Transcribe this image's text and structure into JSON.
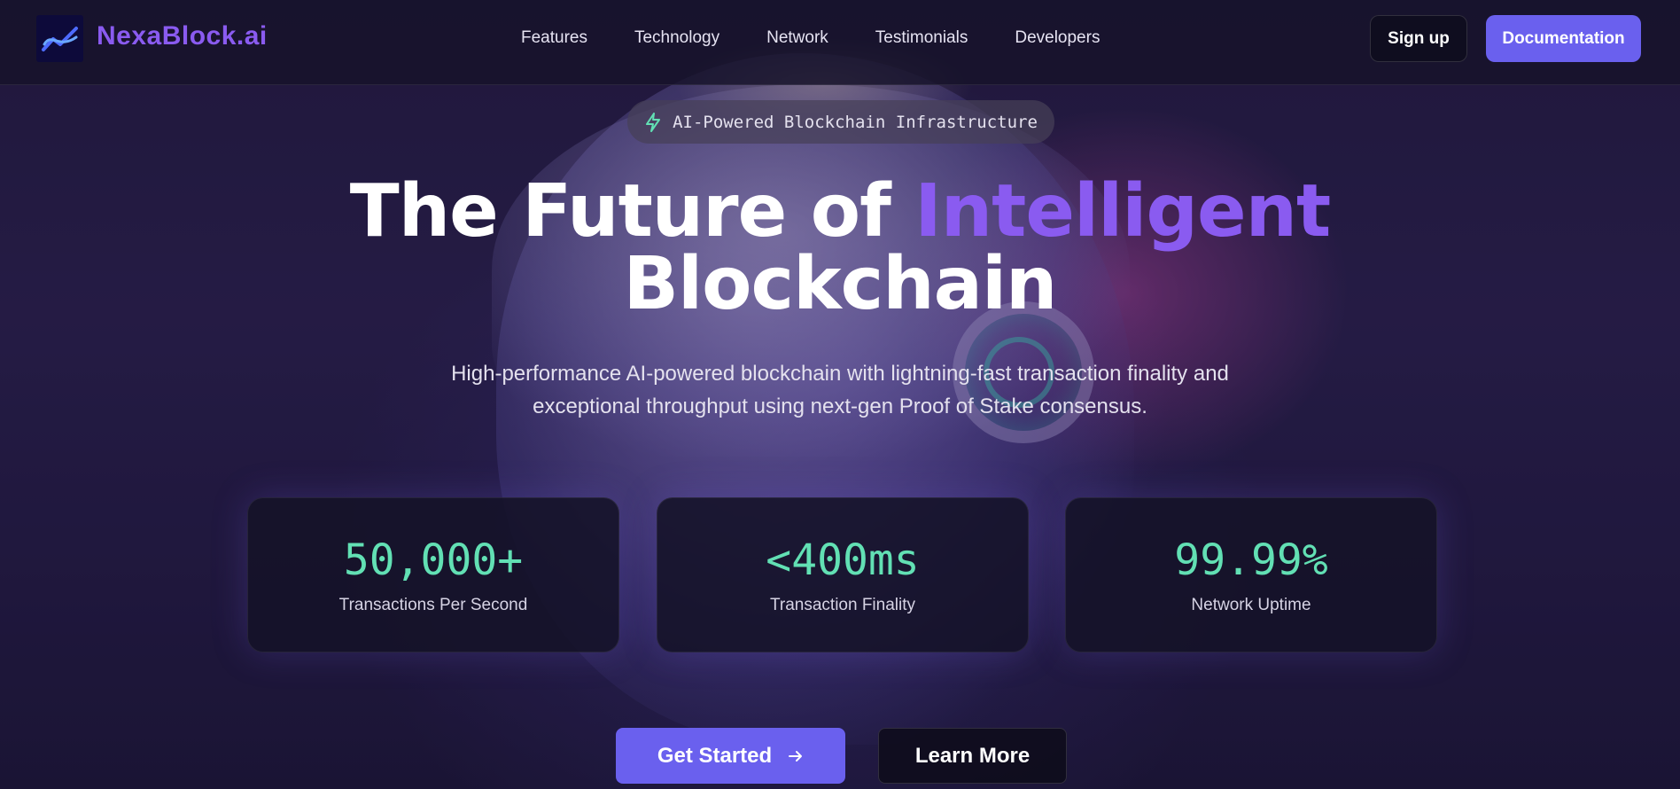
{
  "brand": {
    "name": "NexaBlock.ai",
    "logo_icon": "trend-wave-icon",
    "accent_color": "#8a5bf0"
  },
  "nav": {
    "links": [
      "Features",
      "Technology",
      "Network",
      "Testimonials",
      "Developers"
    ],
    "signup_label": "Sign up",
    "docs_label": "Documentation"
  },
  "hero": {
    "badge_icon": "lightning-icon",
    "badge_text": "AI-Powered Blockchain Infrastructure",
    "headline_part1": "The Future of ",
    "headline_accent": "Intelligent",
    "headline_part2": "Blockchain",
    "subtitle_line1": "High-performance AI-powered blockchain with lightning-fast transaction finality and",
    "subtitle_line2": "exceptional throughput using next-gen Proof of Stake consensus.",
    "stats": [
      {
        "value": "50,000+",
        "label": "Transactions Per Second"
      },
      {
        "value": "<400ms",
        "label": "Transaction Finality"
      },
      {
        "value": "99.99%",
        "label": "Network Uptime"
      }
    ],
    "primary_cta": "Get Started",
    "primary_cta_icon": "arrow-right-icon",
    "secondary_cta": "Learn More"
  },
  "colors": {
    "primary_button": "#6a60ee",
    "stat_value": "#62e0b4",
    "background": "#231b45"
  }
}
